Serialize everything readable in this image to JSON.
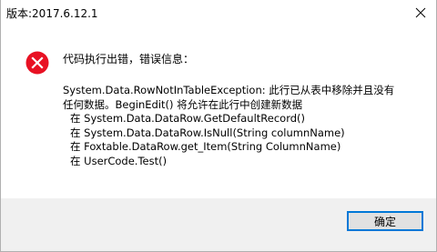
{
  "window": {
    "title": "版本:2017.6.12.1",
    "close_icon": "close-icon"
  },
  "message": {
    "icon": "error-icon",
    "icon_color": "#e81123",
    "heading": "代码执行出错，错误信息：",
    "lines": [
      "System.Data.RowNotInTableException: 此行已从表中移除并且没有",
      "任何数据。BeginEdit() 将允许在此行中创建新数据",
      "在 System.Data.DataRow.GetDefaultRecord()",
      "在 System.Data.DataRow.IsNull(String columnName)",
      "在 Foxtable.DataRow.get_Item(String ColumnName)",
      "在 UserCode.Test()"
    ]
  },
  "footer": {
    "ok_label": "确定",
    "accent": "#0078d7"
  }
}
